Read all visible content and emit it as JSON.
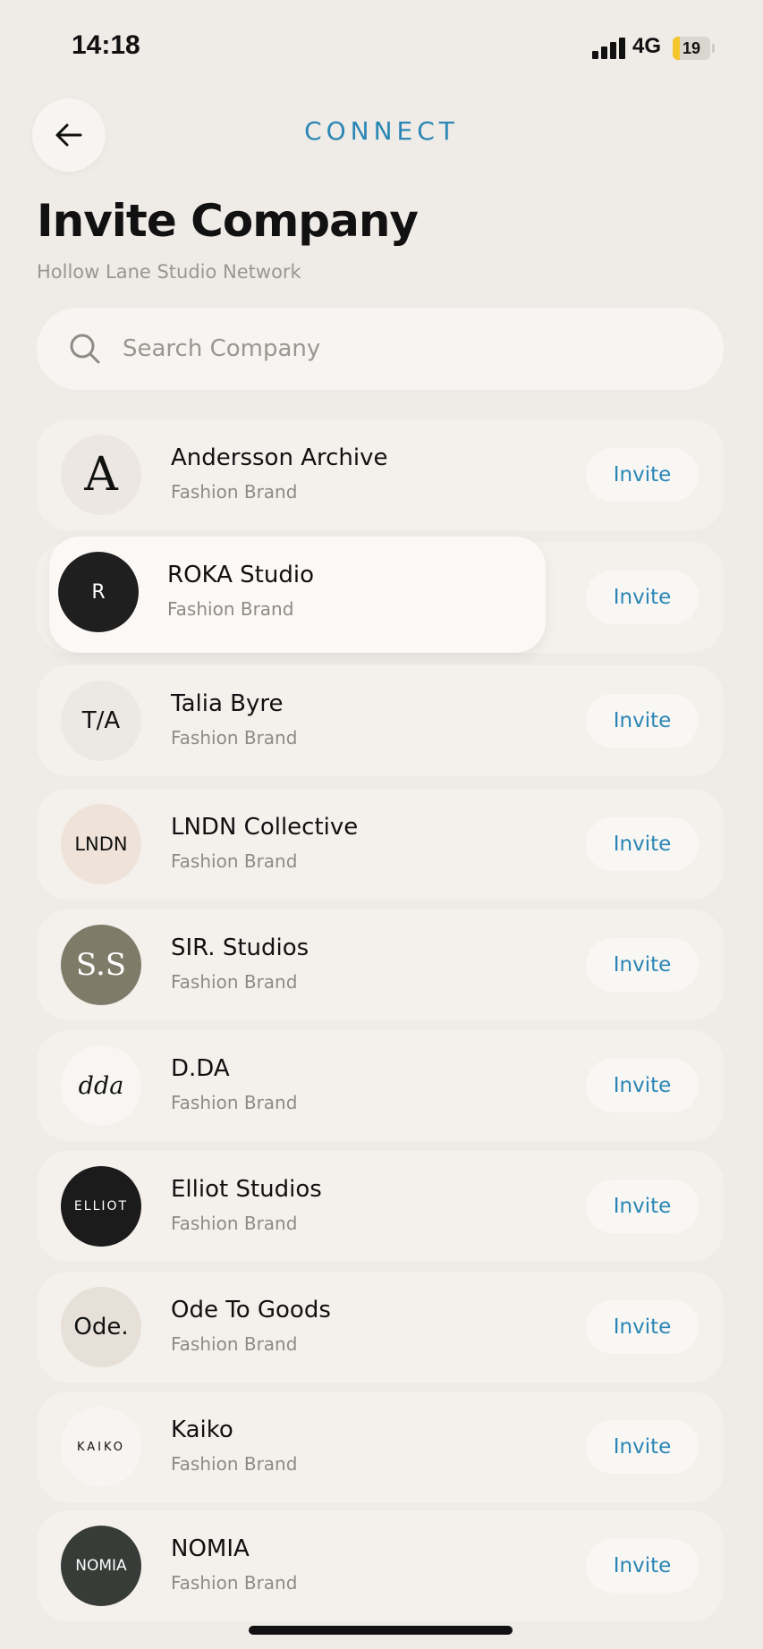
{
  "status": {
    "time": "14:18",
    "network": "4G",
    "battery": "19",
    "battery_level": 0.19,
    "battery_color": "#f5c62c"
  },
  "header": {
    "title": "CONNECT",
    "back_icon": "arrow-left-icon",
    "accent_color": "#2a86b5"
  },
  "page": {
    "title": "Invite Company",
    "subtitle": "Hollow Lane Studio Network"
  },
  "search": {
    "placeholder": "Search Company",
    "value": "",
    "icon": "search-icon"
  },
  "companies": [
    {
      "name": "Andersson Archive",
      "type": "Fashion Brand",
      "logo_text": "A",
      "logo_bg": "#ece7e2",
      "logo_color": "#111",
      "action": "Invite"
    },
    {
      "name": "ROKA Studio",
      "type": "Fashion Brand",
      "logo_text": "R",
      "logo_bg": "#1f1f1f",
      "logo_color": "#ffffff",
      "action": "Invite"
    },
    {
      "name": "Talia Byre",
      "type": "Fashion Brand",
      "logo_text": "T/A",
      "logo_bg": "#ece8e4",
      "logo_color": "#111",
      "action": "Invite"
    },
    {
      "name": "LNDN Collective",
      "type": "Fashion Brand",
      "logo_text": "LNDN",
      "logo_bg": "#efe3d9",
      "logo_color": "#111",
      "action": "Invite"
    },
    {
      "name": "SIR. Studios",
      "type": "Fashion Brand",
      "logo_text": "S.S",
      "logo_bg": "#7f7b69",
      "logo_color": "#ffffff",
      "action": "Invite"
    },
    {
      "name": "D.DA",
      "type": "Fashion Brand",
      "logo_text": "dda",
      "logo_bg": "#f8f6f3",
      "logo_color": "#111",
      "action": "Invite"
    },
    {
      "name": "Elliot Studios",
      "type": "Fashion Brand",
      "logo_text": "ELLIOT",
      "logo_bg": "#1b1b1b",
      "logo_color": "#ffffff",
      "action": "Invite"
    },
    {
      "name": "Ode To Goods",
      "type": "Fashion Brand",
      "logo_text": "Ode.",
      "logo_bg": "#e7e0d8",
      "logo_color": "#111",
      "action": "Invite"
    },
    {
      "name": "Kaiko",
      "type": "Fashion Brand",
      "logo_text": "KAIKO",
      "logo_bg": "#f7f5f2",
      "logo_color": "#111",
      "action": "Invite"
    },
    {
      "name": "NOMIA",
      "type": "Fashion Brand",
      "logo_text": "NOMIA",
      "logo_bg": "#383c38",
      "logo_color": "#ffffff",
      "action": "Invite"
    }
  ]
}
